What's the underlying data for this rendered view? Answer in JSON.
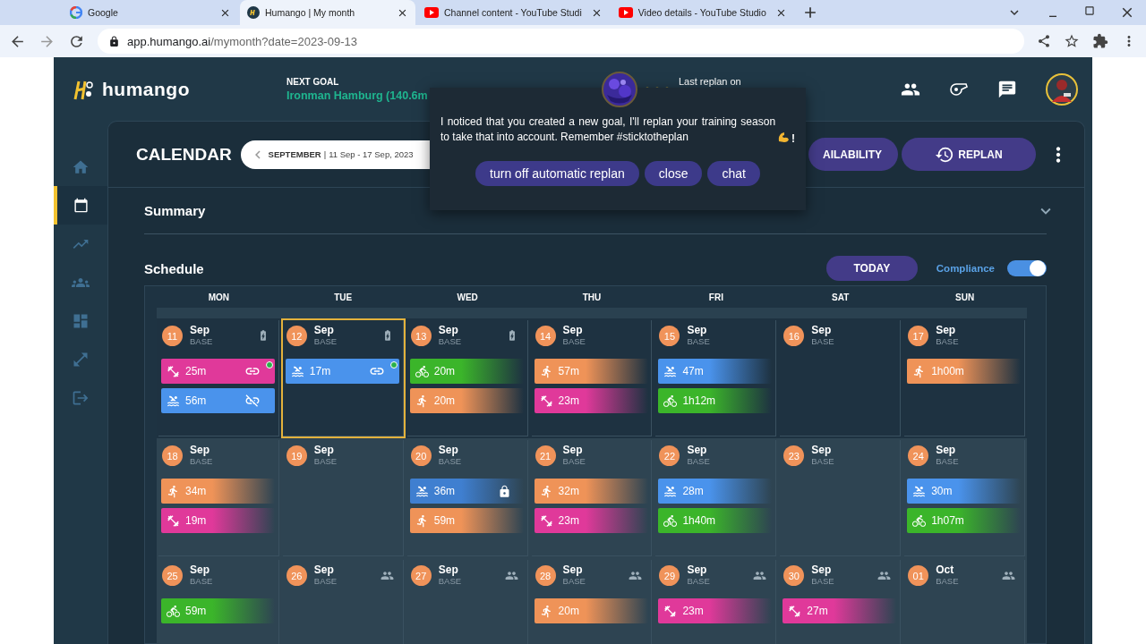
{
  "browser": {
    "tabs": [
      {
        "kind": "google",
        "title": "Google",
        "selected": false
      },
      {
        "kind": "humango",
        "title": "Humango | My month",
        "selected": true
      },
      {
        "kind": "youtube",
        "title": "Channel content - YouTube Studi",
        "selected": false
      },
      {
        "kind": "youtube",
        "title": "Video details - YouTube Studio",
        "selected": false
      }
    ],
    "url_host": "app.humango.ai",
    "url_path": "/mymonth?date=2023-09-13"
  },
  "header": {
    "logo": "humango",
    "next_goal_label": "NEXT GOAL",
    "next_goal": "Ironman Hamburg (140.6m",
    "last_replan": "Last replan on"
  },
  "sidebar": [
    {
      "kind": "home",
      "selected": false
    },
    {
      "kind": "calendar",
      "selected": true
    },
    {
      "kind": "trend",
      "selected": false
    },
    {
      "kind": "team",
      "selected": false
    },
    {
      "kind": "grid",
      "selected": false
    },
    {
      "kind": "expand",
      "selected": false
    },
    {
      "kind": "logout",
      "selected": false
    }
  ],
  "calendar": {
    "title": "CALENDAR",
    "month": "SEPTEMBER",
    "separator": "|",
    "range": "11 Sep - 17 Sep, 2023",
    "buttons": [
      {
        "kind": "availability",
        "label": "AILABILITY"
      },
      {
        "kind": "replan",
        "label": "REPLAN"
      }
    ]
  },
  "popup": {
    "message": "I noticed that you created a new goal, I'll replan your training season to take that into account. Remember #sticktotheplan",
    "message_end": "!",
    "buttons": [
      "turn off automatic replan",
      "close",
      "chat"
    ]
  },
  "summary": {
    "title": "Summary"
  },
  "schedule": {
    "title": "Schedule",
    "today": "TODAY",
    "compliance": {
      "label": "Compliance",
      "on": true
    },
    "days": [
      "MON",
      "TUE",
      "WED",
      "THU",
      "FRI",
      "SAT",
      "SUN"
    ],
    "weeks": [
      {
        "current": true,
        "days": [
          {
            "day": "11",
            "month": "Sep",
            "phase": "BASE",
            "selected": false,
            "battery": true,
            "workouts": [
              {
                "kind": "strength",
                "duration": "25m",
                "past": true,
                "linked": true,
                "done": true
              },
              {
                "kind": "swim",
                "duration": "56m",
                "past": true,
                "linked": false
              }
            ]
          },
          {
            "day": "12",
            "month": "Sep",
            "phase": "BASE",
            "selected": true,
            "battery": true,
            "workouts": [
              {
                "kind": "swim",
                "duration": "17m",
                "past": true,
                "linked": true,
                "done": true
              }
            ]
          },
          {
            "day": "13",
            "month": "Sep",
            "phase": "BASE",
            "selected": false,
            "battery": true,
            "workouts": [
              {
                "kind": "bike",
                "duration": "20m",
                "past": false
              },
              {
                "kind": "run",
                "duration": "20m",
                "past": false
              }
            ]
          },
          {
            "day": "14",
            "month": "Sep",
            "phase": "BASE",
            "selected": false,
            "workouts": [
              {
                "kind": "run",
                "duration": "57m",
                "past": false
              },
              {
                "kind": "strength",
                "duration": "23m",
                "past": false
              }
            ]
          },
          {
            "day": "15",
            "month": "Sep",
            "phase": "BASE",
            "selected": false,
            "workouts": [
              {
                "kind": "swim",
                "duration": "47m",
                "past": false
              },
              {
                "kind": "bike",
                "duration": "1h12m",
                "past": false
              }
            ]
          },
          {
            "day": "16",
            "month": "Sep",
            "phase": "BASE",
            "selected": false
          },
          {
            "day": "17",
            "month": "Sep",
            "phase": "BASE",
            "selected": false,
            "workouts": [
              {
                "kind": "run",
                "duration": "1h00m",
                "past": false
              }
            ]
          }
        ]
      },
      {
        "current": false,
        "days": [
          {
            "day": "18",
            "month": "Sep",
            "phase": "BASE",
            "selected": false,
            "workouts": [
              {
                "kind": "run",
                "duration": "34m",
                "past": false
              },
              {
                "kind": "strength",
                "duration": "19m",
                "past": false
              }
            ]
          },
          {
            "day": "19",
            "month": "Sep",
            "phase": "BASE",
            "selected": false
          },
          {
            "day": "20",
            "month": "Sep",
            "phase": "BASE",
            "selected": false,
            "workouts": [
              {
                "kind": "swim",
                "duration": "36m",
                "past": false,
                "locked": true
              },
              {
                "kind": "run",
                "duration": "59m",
                "past": false
              }
            ]
          },
          {
            "day": "21",
            "month": "Sep",
            "phase": "BASE",
            "selected": false,
            "workouts": [
              {
                "kind": "run",
                "duration": "32m",
                "past": false
              },
              {
                "kind": "strength",
                "duration": "23m",
                "past": false
              }
            ]
          },
          {
            "day": "22",
            "month": "Sep",
            "phase": "BASE",
            "selected": false,
            "workouts": [
              {
                "kind": "swim",
                "duration": "28m",
                "past": false
              },
              {
                "kind": "bike",
                "duration": "1h40m",
                "past": false
              }
            ]
          },
          {
            "day": "23",
            "month": "Sep",
            "phase": "BASE",
            "selected": false
          },
          {
            "day": "24",
            "month": "Sep",
            "phase": "BASE",
            "selected": false,
            "workouts": [
              {
                "kind": "swim",
                "duration": "30m",
                "past": false
              },
              {
                "kind": "bike",
                "duration": "1h07m",
                "past": false
              }
            ]
          }
        ]
      },
      {
        "current": false,
        "days": [
          {
            "day": "25",
            "month": "Sep",
            "phase": "BASE",
            "selected": false,
            "workouts": [
              {
                "kind": "bike",
                "duration": "59m",
                "past": false
              }
            ]
          },
          {
            "day": "26",
            "month": "Sep",
            "phase": "BASE",
            "selected": false,
            "team": true
          },
          {
            "day": "27",
            "month": "Sep",
            "phase": "BASE",
            "selected": false,
            "team": true
          },
          {
            "day": "28",
            "month": "Sep",
            "phase": "BASE",
            "selected": false,
            "team": true,
            "workouts": [
              {
                "kind": "run",
                "duration": "20m",
                "past": false
              }
            ]
          },
          {
            "day": "29",
            "month": "Sep",
            "phase": "BASE",
            "selected": false,
            "team": true,
            "workouts": [
              {
                "kind": "strength",
                "duration": "23m",
                "past": false
              }
            ]
          },
          {
            "day": "30",
            "month": "Sep",
            "phase": "BASE",
            "selected": false,
            "team": true,
            "workouts": [
              {
                "kind": "strength",
                "duration": "27m",
                "past": false
              }
            ]
          },
          {
            "day": "01",
            "month": "Oct",
            "phase": "BASE",
            "selected": false,
            "team": true
          }
        ]
      }
    ]
  }
}
